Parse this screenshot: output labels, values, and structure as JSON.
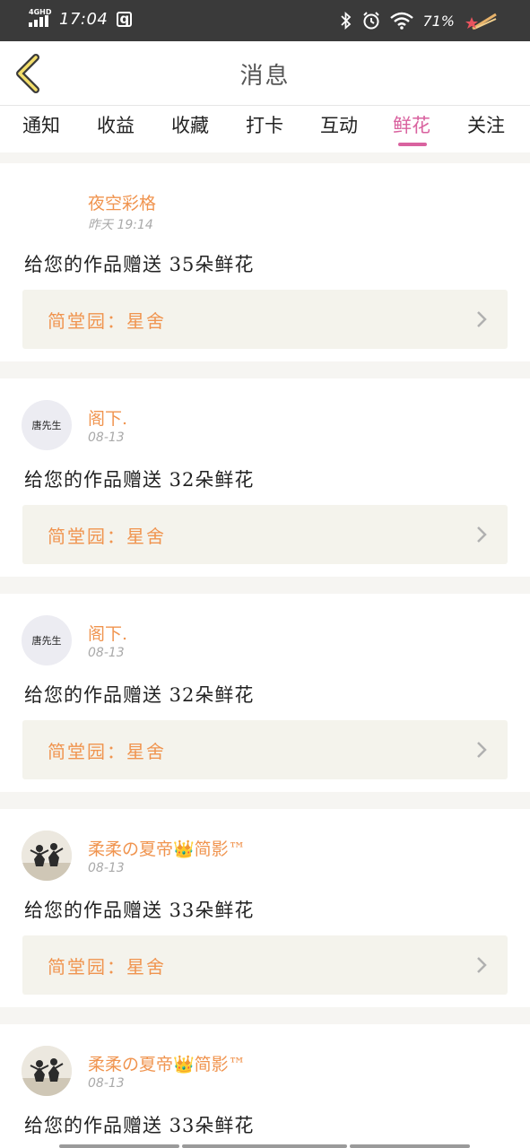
{
  "status_bar": {
    "network": "4GHD",
    "time": "17:04",
    "battery": "71%",
    "icons": [
      "signal-icon",
      "app-notification-icon",
      "bluetooth-icon",
      "alarm-icon",
      "wifi-icon",
      "shooting-star-icon"
    ]
  },
  "header": {
    "title": "消息",
    "back_icon": "chevron-left-icon"
  },
  "tabs": [
    {
      "label": "通知",
      "active": false
    },
    {
      "label": "收益",
      "active": false
    },
    {
      "label": "收藏",
      "active": false
    },
    {
      "label": "打卡",
      "active": false
    },
    {
      "label": "互动",
      "active": false
    },
    {
      "label": "鲜花",
      "active": true
    },
    {
      "label": "关注",
      "active": false
    }
  ],
  "colors": {
    "accent": "#d9629f",
    "sender": "#f0944f",
    "card_link_bg": "#f4f3ec",
    "status_bar": "#3a3a3a"
  },
  "messages": [
    {
      "sender": "夜空彩格",
      "time": "昨天 19:14",
      "text": "给您的作品赠送 35朵鲜花",
      "work": "简堂园：星舍",
      "avatar": "blank"
    },
    {
      "sender": "阁下.",
      "time": "08-13",
      "text": "给您的作品赠送 32朵鲜花",
      "work": "简堂园：星舍",
      "avatar": "text",
      "avatar_text": "唐先生"
    },
    {
      "sender": "阁下.",
      "time": "08-13",
      "text": "给您的作品赠送 32朵鲜花",
      "work": "简堂园：星舍",
      "avatar": "text",
      "avatar_text": "唐先生"
    },
    {
      "sender": "柔柔の夏帝👑简影™",
      "time": "08-13",
      "text": "给您的作品赠送 33朵鲜花",
      "work": "简堂园：星舍",
      "avatar": "photo"
    },
    {
      "sender": "柔柔の夏帝👑简影™",
      "time": "08-13",
      "text": "给您的作品赠送 33朵鲜花",
      "work": "简堂园：星舍",
      "avatar": "photo"
    }
  ]
}
